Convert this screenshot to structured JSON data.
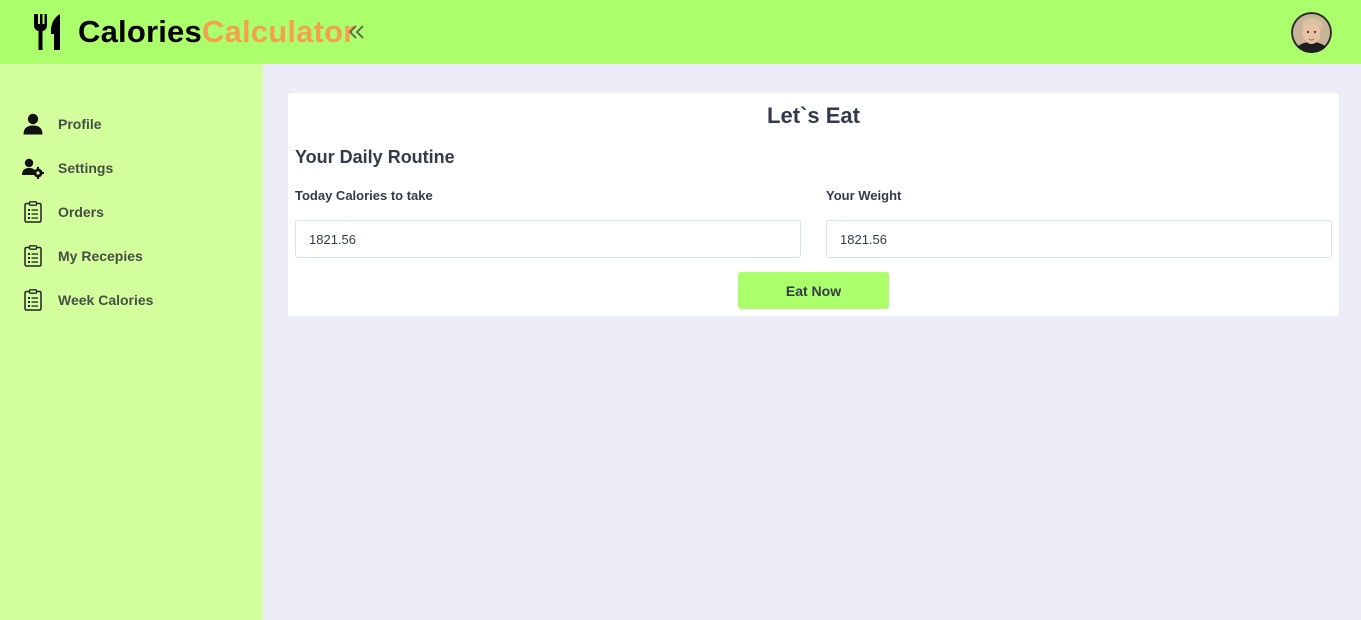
{
  "header": {
    "brand_part1": "Calories",
    "brand_part2": "Calculator",
    "logo_icon": "fork-knife-icon",
    "collapse_icon": "double-chevron-left-icon",
    "avatar_icon": "user-avatar",
    "bg_color": "#abff6b",
    "brand_accent_color": "#f4a14f"
  },
  "sidebar": {
    "bg_color": "#d3ff9c",
    "items": [
      {
        "label": "Profile",
        "icon": "user-icon"
      },
      {
        "label": "Settings",
        "icon": "users-cog-icon"
      },
      {
        "label": "Orders",
        "icon": "clipboard-list-icon"
      },
      {
        "label": "My Recepies",
        "icon": "clipboard-list-icon"
      },
      {
        "label": "Week Calories",
        "icon": "clipboard-list-icon"
      }
    ]
  },
  "main": {
    "title": "Let`s Eat",
    "section_title": "Your Daily Routine",
    "fields": [
      {
        "label": "Today Calories to take",
        "value": "1821.56"
      },
      {
        "label": "Your Weight",
        "value": "1821.56"
      }
    ],
    "submit_label": "Eat Now"
  }
}
